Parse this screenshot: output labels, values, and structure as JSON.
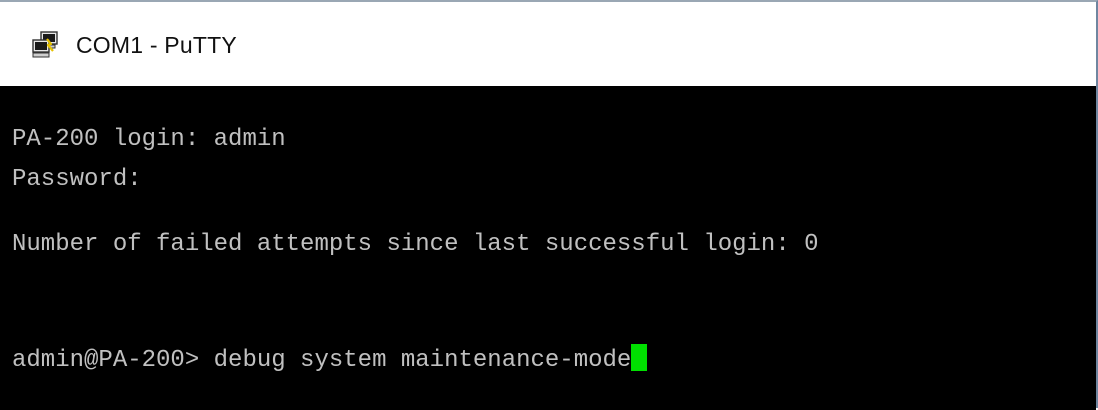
{
  "window": {
    "title": "COM1 - PuTTY",
    "icon": "putty-icon"
  },
  "terminal": {
    "lines": [
      "PA-200 login: admin",
      "Password:",
      "Number of failed attempts since last successful login: 0"
    ],
    "prompt": "admin@PA-200> ",
    "command": "debug system maintenance-mode",
    "text_color": "#c0c0c0",
    "background": "#000000",
    "cursor_color": "#00e000"
  }
}
